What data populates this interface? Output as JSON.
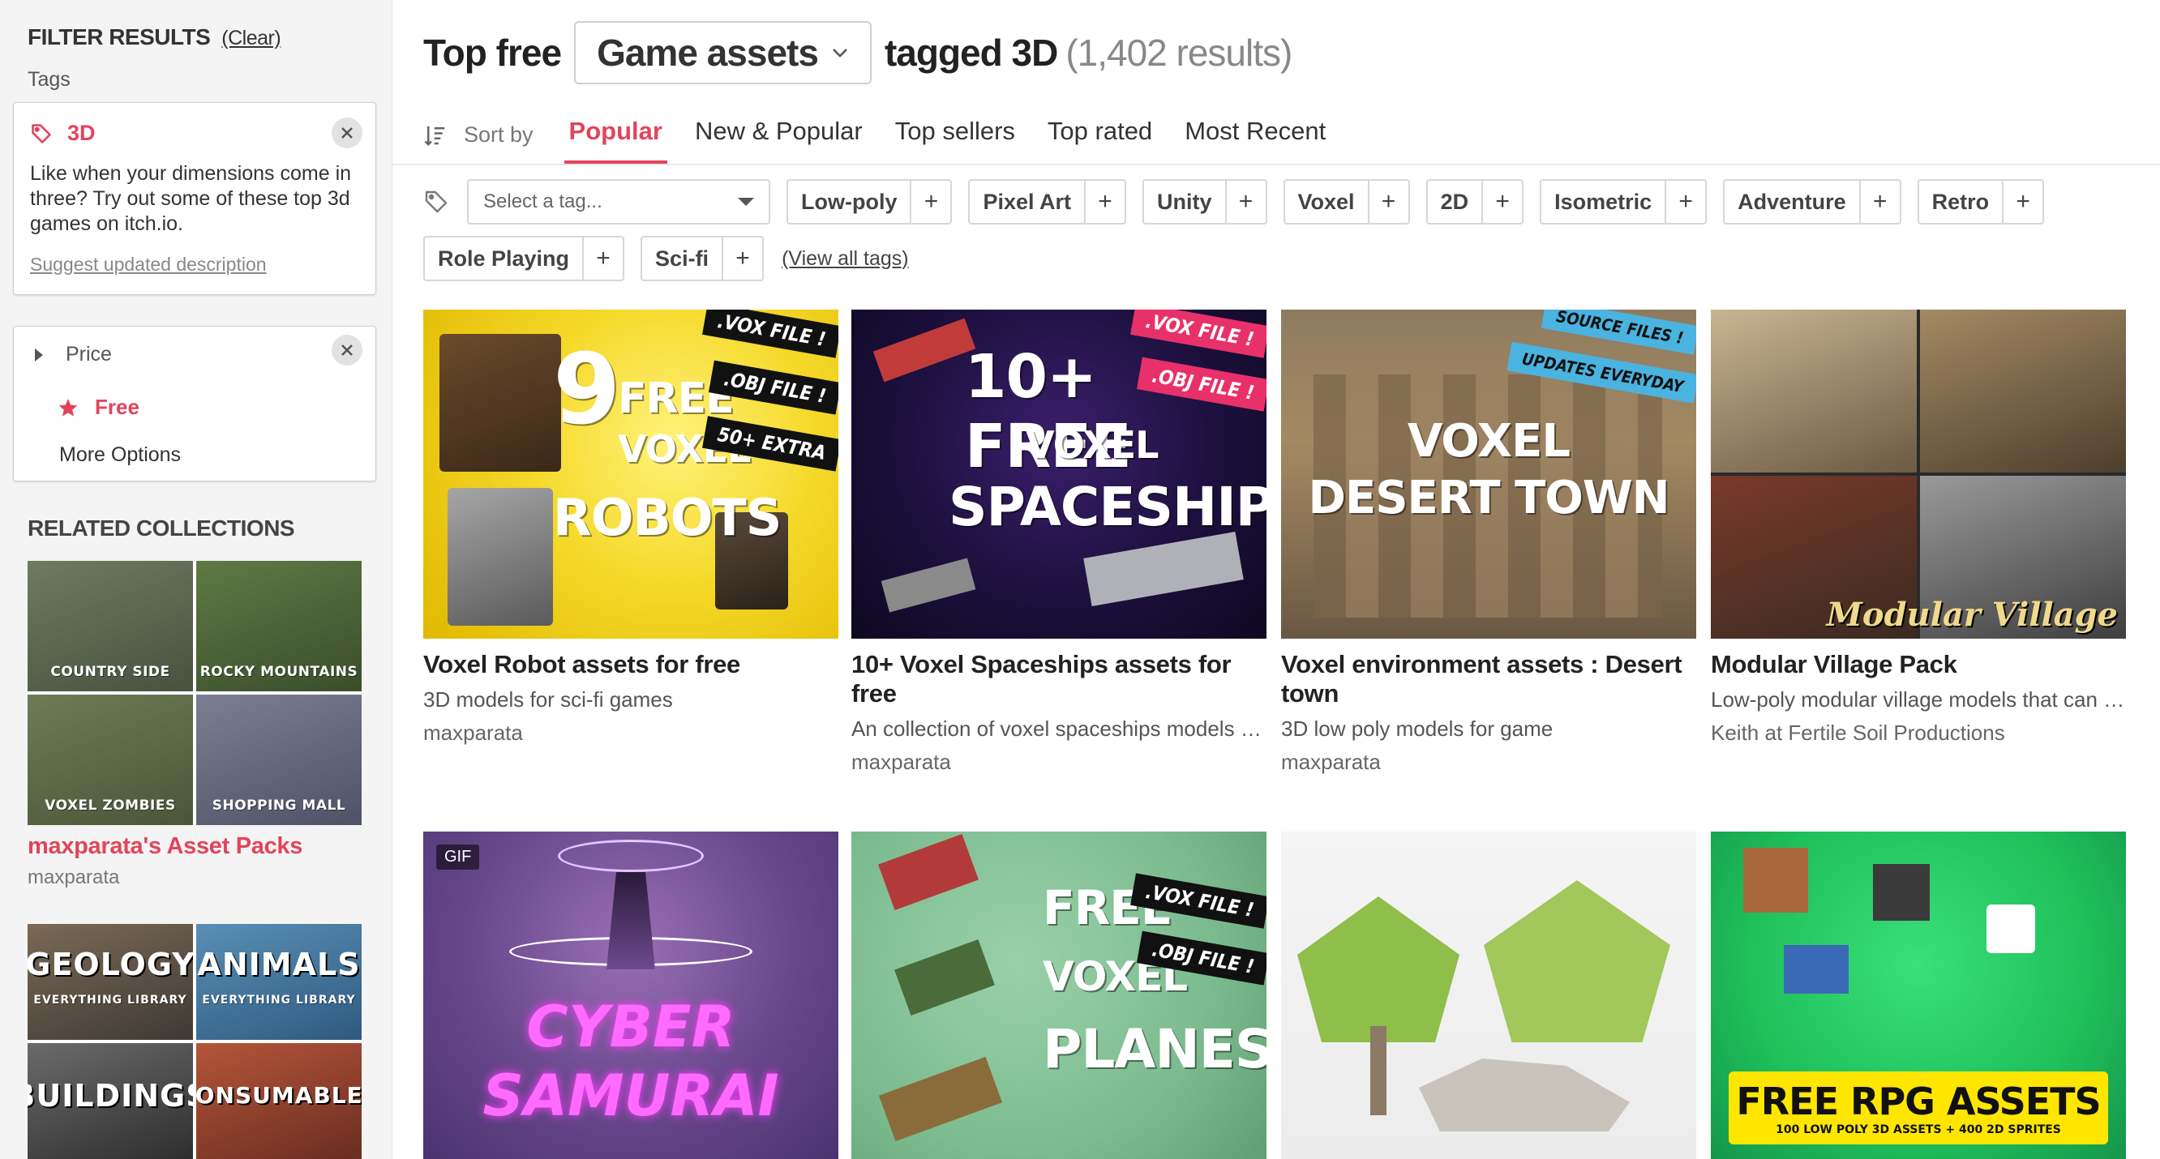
{
  "sidebar": {
    "filter_title": "FILTER RESULTS",
    "clear_label": "(Clear)",
    "tags_label": "Tags",
    "tag": {
      "name": "3D",
      "description": "Like when your dimensions come in three? Try out some of these top 3d games on itch.io.",
      "suggest_link": "Suggest updated description"
    },
    "price": {
      "label": "Price",
      "selected": "Free",
      "more_options": "More Options"
    },
    "related_title": "RELATED COLLECTIONS",
    "collections": [
      {
        "title": "maxparata's Asset Packs",
        "author": "maxparata",
        "tiles": [
          "COUNTRY SIDE",
          "ROCKY MOUNTAINS",
          "VOXEL ZOMBIES",
          "SHOPPING MALL"
        ]
      },
      {
        "tiles": [
          {
            "big": "GEOLOGY",
            "small": "EVERYTHING LIBRARY"
          },
          {
            "big": "ANIMALS",
            "small": "EVERYTHING LIBRARY"
          },
          {
            "big": "BUILDINGS",
            "small": ""
          },
          {
            "big": "CONSUMABLES",
            "small": ""
          }
        ]
      }
    ]
  },
  "header": {
    "prefix": "Top free",
    "category": "Game assets",
    "tagged": "tagged 3D",
    "count": "(1,402 results)"
  },
  "sort": {
    "label": "Sort by",
    "tabs": [
      "Popular",
      "New & Popular",
      "Top sellers",
      "Top rated",
      "Most Recent"
    ],
    "active": 0
  },
  "tag_filter": {
    "placeholder": "Select a tag...",
    "chips_row1": [
      "Low-poly",
      "Pixel Art",
      "Unity",
      "Voxel",
      "2D",
      "Isometric",
      "Adventure",
      "Retro"
    ],
    "chips_row2": [
      "Role Playing",
      "Sci-fi"
    ],
    "view_all": "(View all tags)"
  },
  "games": [
    {
      "title": "Voxel Robot assets for free",
      "description": "3D models for sci-fi games",
      "author": "maxparata",
      "art": {
        "lines": [
          "9",
          "FREE",
          "VOXEL",
          "ROBOTS"
        ],
        "badges": [
          ".VOX FILE !",
          ".OBJ FILE !",
          "50+ EXTRA"
        ]
      }
    },
    {
      "title": "10+ Voxel Spaceships assets for free",
      "description": "An collection of voxel spaceships models (.vox and .obj)",
      "author": "maxparata",
      "art": {
        "lines": [
          "10+ FREE",
          "VOXEL",
          "SPACESHIPS"
        ],
        "badges": [
          ".VOX FILE !",
          ".OBJ FILE !"
        ]
      }
    },
    {
      "title": "Voxel environment assets : Desert town",
      "description": "3D low poly models for game",
      "author": "maxparata",
      "art": {
        "lines": [
          "VOXEL",
          "DESERT TOWN"
        ],
        "badges": [
          "SOURCE FILES !",
          "UPDATES EVERYDAY"
        ]
      }
    },
    {
      "title": "Modular Village Pack",
      "description": "Low-poly modular village models that can be combined",
      "author": "Keith at Fertile Soil Productions",
      "art": {
        "lines": [
          "Modular Village"
        ],
        "badges": []
      }
    },
    {
      "title": "",
      "description": "",
      "author": "",
      "art": {
        "lines": [
          "CYBER",
          "SAMURAI"
        ],
        "badges": [
          "GIF"
        ]
      }
    },
    {
      "title": "",
      "description": "",
      "author": "",
      "art": {
        "lines": [
          "FREE",
          "VOXEL",
          "PLANES"
        ],
        "badges": [
          ".VOX FILE !",
          ".OBJ FILE !"
        ]
      }
    },
    {
      "title": "",
      "description": "",
      "author": "",
      "art": {
        "lines": [],
        "badges": []
      }
    },
    {
      "title": "",
      "description": "",
      "author": "",
      "art": {
        "lines": [
          "FREE RPG ASSETS",
          "100 LOW POLY 3D ASSETS + 400 2D SPRITES"
        ],
        "badges": []
      }
    }
  ],
  "colors": {
    "accent": "#e2445b",
    "sidebar_bg": "#f4f4f4"
  }
}
